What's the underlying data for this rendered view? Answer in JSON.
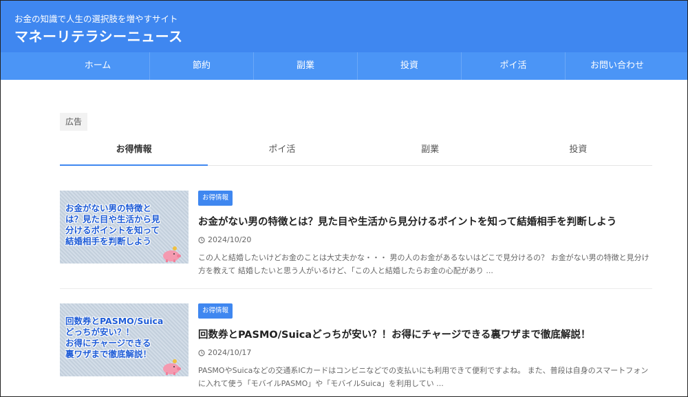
{
  "header": {
    "tagline": "お金の知識で人生の選択肢を増やすサイト",
    "site_title": "マネーリテラシーニュース",
    "bg_color": "#3f87f0"
  },
  "nav": {
    "items": [
      {
        "label": "ホーム"
      },
      {
        "label": "節約"
      },
      {
        "label": "副業"
      },
      {
        "label": "投資"
      },
      {
        "label": "ポイ活"
      },
      {
        "label": "お問い合わせ"
      }
    ]
  },
  "ad_label": "広告",
  "tabs": [
    {
      "label": "お得情報",
      "active": true
    },
    {
      "label": "ポイ活",
      "active": false
    },
    {
      "label": "副業",
      "active": false
    },
    {
      "label": "投資",
      "active": false
    }
  ],
  "articles": [
    {
      "thumb_text": "お金がない男の特徴と\nは？見た目や生活から見\n分けるポイントを知って\n結婚相手を判断しよう",
      "category": "お得情報",
      "title": "お金がない男の特徴とは？見た目や生活から見分けるポイントを知って結婚相手を判断しよう",
      "date": "2024/10/20",
      "excerpt": "この人と結婚したいけどお金のことは大丈夫かな・・・ 男の人のお金があるないはどこで見分けるの？ お金がない男の特徴と見分け方を教えて 結婚したいと思う人がいるけど、「この人と結婚したらお金の心配があり ..."
    },
    {
      "thumb_text": "回数券とPASMO/Suica\nどっちが安い？！\nお得にチャージできる\n裏ワザまで徹底解説！",
      "category": "お得情報",
      "title": "回数券とPASMO/Suicaどっちが安い？！お得にチャージできる裏ワザまで徹底解説！",
      "date": "2024/10/17",
      "excerpt": "PASMOやSuicaなどの交通系ICカードはコンビニなどでの支払いにも利用できて便利ですよね。 また、普段は自身のスマートフォンに入れて使う「モバイルPASMO」や「モバイルSuica」を利用してい ..."
    }
  ]
}
